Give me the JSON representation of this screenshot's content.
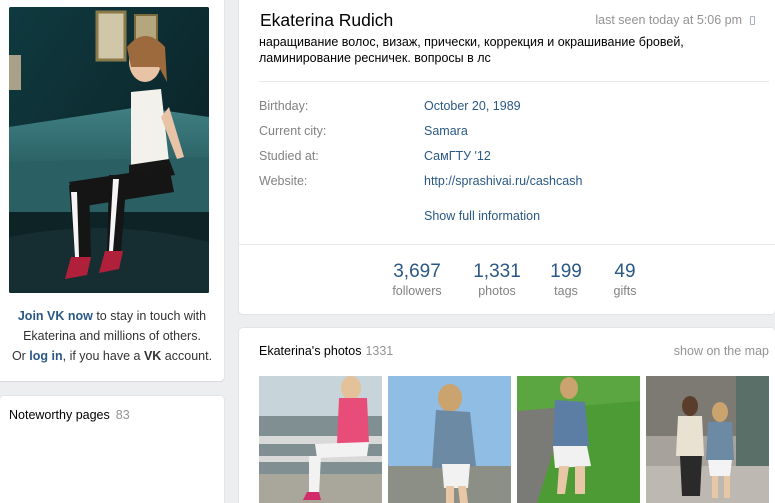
{
  "left": {
    "join_strong": "Join VK now",
    "join_rest": " to stay in touch with",
    "join_line2": "Ekaterina and millions of others.",
    "join_or": "Or ",
    "join_login": "log in",
    "join_if": ", if you have a ",
    "join_vk": "VK",
    "join_account": " account."
  },
  "noteworthy": {
    "label": "Noteworthy pages",
    "count": "83"
  },
  "profile": {
    "name": "Ekaterina Rudich",
    "last_seen": "last seen today at 5:06 pm",
    "status": "наращивание волос, визаж, прически, коррекция и окрашивание бровей, ламинирование ресничек. вопросы в лс",
    "info": [
      {
        "label": "Birthday:",
        "value": "October 20, 1989"
      },
      {
        "label": "Current city:",
        "value": "Samara"
      },
      {
        "label": "Studied at:",
        "value": "СамГТУ '12"
      },
      {
        "label": "Website:",
        "value": "http://sprashivai.ru/cashcash"
      }
    ],
    "show_full": "Show full information",
    "counters": [
      {
        "num": "3,697",
        "label": "followers"
      },
      {
        "num": "1,331",
        "label": "photos"
      },
      {
        "num": "199",
        "label": "tags"
      },
      {
        "num": "49",
        "label": "gifts"
      }
    ]
  },
  "photos": {
    "title": "Ekaterina's photos",
    "count": "1331",
    "map_link": "show on the map"
  },
  "icons": {
    "phone": "mobile-phone-icon"
  },
  "colors": {
    "link": "#2a5885",
    "muted": "#828282",
    "background": "#edeef0"
  }
}
